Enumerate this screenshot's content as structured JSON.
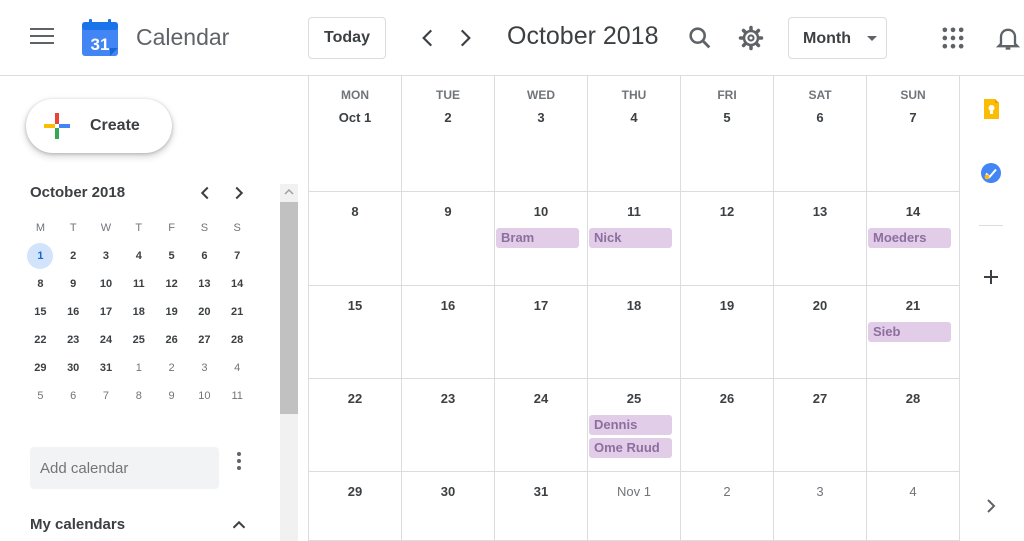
{
  "header": {
    "app_title": "Calendar",
    "logo_day": "31",
    "today_label": "Today",
    "period_title": "October 2018",
    "view_label": "Month"
  },
  "sidebar": {
    "create_label": "Create",
    "mini_calendar": {
      "title": "October 2018",
      "weekdays": [
        "M",
        "T",
        "W",
        "T",
        "F",
        "S",
        "S"
      ],
      "weeks": [
        [
          "1",
          "2",
          "3",
          "4",
          "5",
          "6",
          "7"
        ],
        [
          "8",
          "9",
          "10",
          "11",
          "12",
          "13",
          "14"
        ],
        [
          "15",
          "16",
          "17",
          "18",
          "19",
          "20",
          "21"
        ],
        [
          "22",
          "23",
          "24",
          "25",
          "26",
          "27",
          "28"
        ],
        [
          "29",
          "30",
          "31",
          "1",
          "2",
          "3",
          "4"
        ],
        [
          "5",
          "6",
          "7",
          "8",
          "9",
          "10",
          "11"
        ]
      ],
      "today": "1"
    },
    "add_calendar_placeholder": "Add calendar",
    "my_calendars_label": "My calendars"
  },
  "month": {
    "weekdays": [
      "MON",
      "TUE",
      "WED",
      "THU",
      "FRI",
      "SAT",
      "SUN"
    ],
    "weeks": [
      [
        {
          "d": "Oct 1"
        },
        {
          "d": "2"
        },
        {
          "d": "3"
        },
        {
          "d": "4"
        },
        {
          "d": "5"
        },
        {
          "d": "6"
        },
        {
          "d": "7"
        }
      ],
      [
        {
          "d": "8"
        },
        {
          "d": "9"
        },
        {
          "d": "10",
          "events": [
            "Bram"
          ]
        },
        {
          "d": "11",
          "events": [
            "Nick"
          ]
        },
        {
          "d": "12"
        },
        {
          "d": "13"
        },
        {
          "d": "14",
          "events": [
            "Moeders"
          ]
        }
      ],
      [
        {
          "d": "15"
        },
        {
          "d": "16"
        },
        {
          "d": "17"
        },
        {
          "d": "18"
        },
        {
          "d": "19"
        },
        {
          "d": "20"
        },
        {
          "d": "21",
          "events": [
            "Sieb"
          ]
        }
      ],
      [
        {
          "d": "22"
        },
        {
          "d": "23"
        },
        {
          "d": "24"
        },
        {
          "d": "25",
          "events": [
            "Dennis",
            "Ome Ruud"
          ]
        },
        {
          "d": "26"
        },
        {
          "d": "27"
        },
        {
          "d": "28"
        }
      ],
      [
        {
          "d": "29"
        },
        {
          "d": "30"
        },
        {
          "d": "31"
        },
        {
          "d": "Nov 1",
          "muted": true
        },
        {
          "d": "2",
          "muted": true
        },
        {
          "d": "3",
          "muted": true
        },
        {
          "d": "4",
          "muted": true
        }
      ]
    ]
  },
  "colors": {
    "event_bg": "#e1cde8",
    "event_text": "#8d6e9e",
    "today_bg": "#d2e3fc",
    "logo_blue": "#4285f4",
    "keep_yellow": "#fbbc04",
    "tasks_blue": "#4285f4"
  },
  "icons": [
    "menu-icon",
    "calendar-logo-icon",
    "chevron-left-icon",
    "chevron-right-icon",
    "search-icon",
    "gear-icon",
    "apps-grid-icon",
    "bell-icon",
    "keep-icon",
    "tasks-icon",
    "plus-icon"
  ]
}
